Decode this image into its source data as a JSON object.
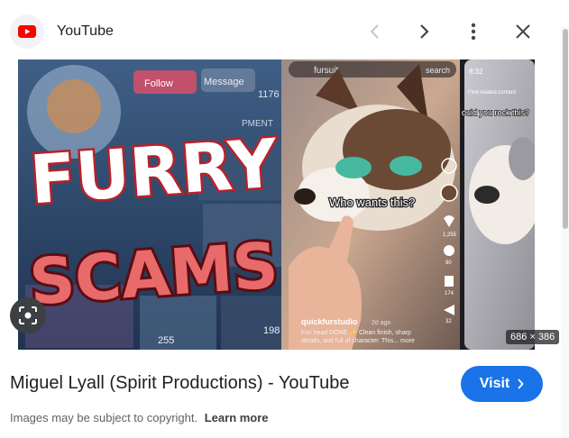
{
  "header": {
    "site_name": "YouTube",
    "icons": [
      "youtube-logo",
      "chevron-left",
      "chevron-right",
      "more-vert",
      "close"
    ]
  },
  "preview": {
    "dimensions": "686 × 386",
    "thumbnail_text": {
      "headline_top": "FURRY",
      "headline_bottom": "SCAMS",
      "follow": "Follow",
      "message": "Message",
      "count": "1176",
      "partial_label": "PMENT",
      "search_query": "fursuit",
      "search_action": "search",
      "caption": "Who wants this?",
      "username": "quickfurstudio",
      "time_ago": "2d ago",
      "description_line1": "Fox head DONE ✨ Clean finish, sharp",
      "description_line2": "details, and full of character. This... more",
      "likes": "1,255",
      "comments": "90",
      "saves": "174",
      "shares": "32",
      "views_a": "255",
      "views_b": "198",
      "phone_time": "8:32",
      "phone_caption": "ould you rock this?",
      "phone_search": "Find related content"
    }
  },
  "result": {
    "title": "Miguel Lyall (Spirit Productions) - YouTube",
    "visit_label": "Visit",
    "copyright_text": "Images may be subject to copyright.",
    "learn_more": "Learn more"
  },
  "colors": {
    "accent": "#1a73e8",
    "youtube_red": "#ff0000",
    "scams_red": "#d63a3a"
  }
}
